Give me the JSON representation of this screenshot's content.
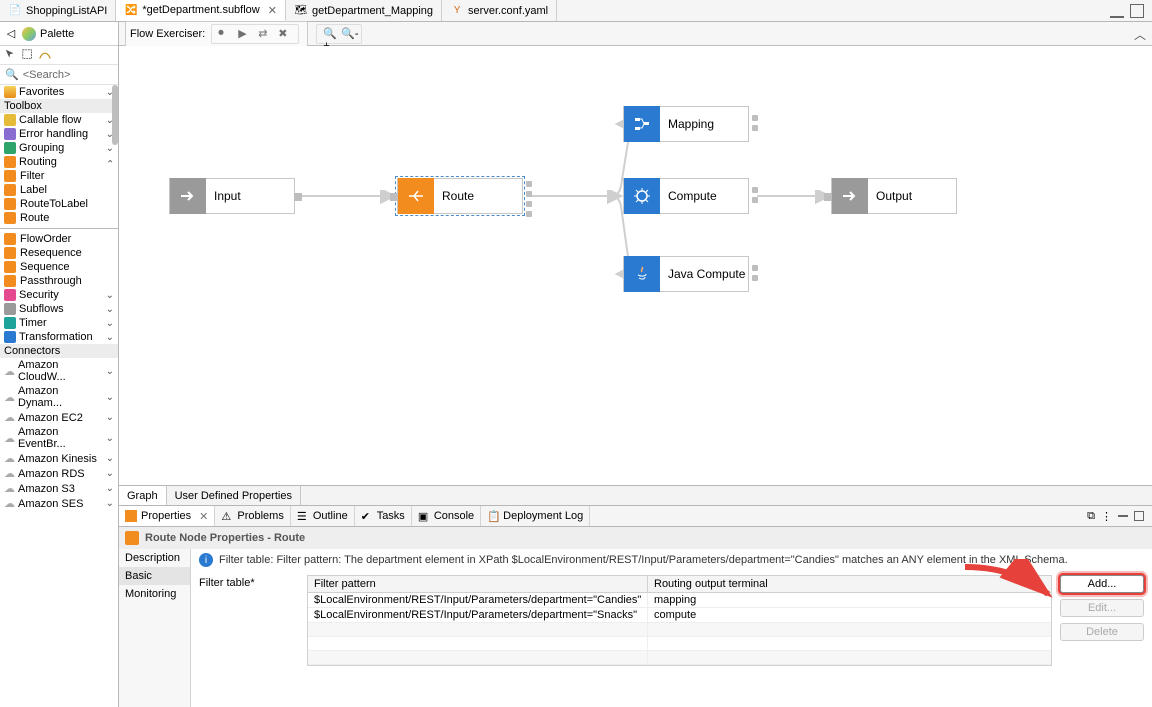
{
  "tabs": [
    {
      "label": "ShoppingListAPI",
      "icon": "api-icon"
    },
    {
      "label": "*getDepartment.subflow",
      "icon": "subflow-icon",
      "active": true,
      "closable": true
    },
    {
      "label": "getDepartment_Mapping",
      "icon": "map-icon"
    },
    {
      "label": "server.conf.yaml",
      "icon": "yaml-icon"
    }
  ],
  "palette": {
    "title": "Palette",
    "search_placeholder": "<Search>",
    "favorites": "Favorites",
    "sections": {
      "toolbox": "Toolbox",
      "connectors": "Connectors"
    },
    "cats": [
      {
        "label": "Callable flow",
        "color": "c-gold",
        "chev": true
      },
      {
        "label": "Error handling",
        "color": "c-purple",
        "chev": true
      },
      {
        "label": "Grouping",
        "color": "c-green",
        "chev": true
      },
      {
        "label": "Routing",
        "color": "c-orange",
        "chev": true,
        "expanded": true,
        "items": [
          {
            "label": "Filter",
            "color": "c-orange"
          },
          {
            "label": "Label",
            "color": "c-orange"
          },
          {
            "label": "RouteToLabel",
            "color": "c-orange"
          },
          {
            "label": "Route",
            "color": "c-orange"
          }
        ],
        "items2": [
          {
            "label": "FlowOrder",
            "color": "c-orange"
          },
          {
            "label": "Resequence",
            "color": "c-orange"
          },
          {
            "label": "Sequence",
            "color": "c-orange"
          },
          {
            "label": "Passthrough",
            "color": "c-orange"
          }
        ]
      },
      {
        "label": "Security",
        "color": "c-pink",
        "chev": true
      },
      {
        "label": "Subflows",
        "color": "c-grey",
        "chev": true
      },
      {
        "label": "Timer",
        "color": "c-teal",
        "chev": true
      },
      {
        "label": "Transformation",
        "color": "c-blue",
        "chev": true
      }
    ],
    "connectors": [
      "Amazon CloudW...",
      "Amazon Dynam...",
      "Amazon EC2",
      "Amazon EventBr...",
      "Amazon Kinesis",
      "Amazon RDS",
      "Amazon S3",
      "Amazon SES"
    ]
  },
  "flow_exerciser": {
    "label": "Flow Exerciser:"
  },
  "nodes": {
    "input": "Input",
    "route": "Route",
    "mapping": "Mapping",
    "compute": "Compute",
    "java": "Java Compute",
    "output": "Output"
  },
  "bottom_tabs": {
    "graph": "Graph",
    "udp": "User Defined Properties"
  },
  "views": [
    {
      "label": "Properties",
      "active": true,
      "closable": true
    },
    {
      "label": "Problems"
    },
    {
      "label": "Outline"
    },
    {
      "label": "Tasks"
    },
    {
      "label": "Console"
    },
    {
      "label": "Deployment Log"
    }
  ],
  "properties": {
    "header": "Route Node Properties - Route",
    "left": [
      "Description",
      "Basic",
      "Monitoring"
    ],
    "left_active": "Basic",
    "info": "Filter table: Filter pattern: The department element in XPath $LocalEnvironment/REST/Input/Parameters/department=\"Candies\" matches an ANY element in the XML Schema.",
    "filter_label": "Filter table*",
    "col1": "Filter pattern",
    "col2": "Routing output terminal",
    "rows": [
      {
        "pattern": "$LocalEnvironment/REST/Input/Parameters/department=\"Candies\"",
        "terminal": "mapping"
      },
      {
        "pattern": "$LocalEnvironment/REST/Input/Parameters/department=\"Snacks\"",
        "terminal": "compute"
      }
    ],
    "buttons": {
      "add": "Add...",
      "edit": "Edit...",
      "delete": "Delete"
    }
  }
}
